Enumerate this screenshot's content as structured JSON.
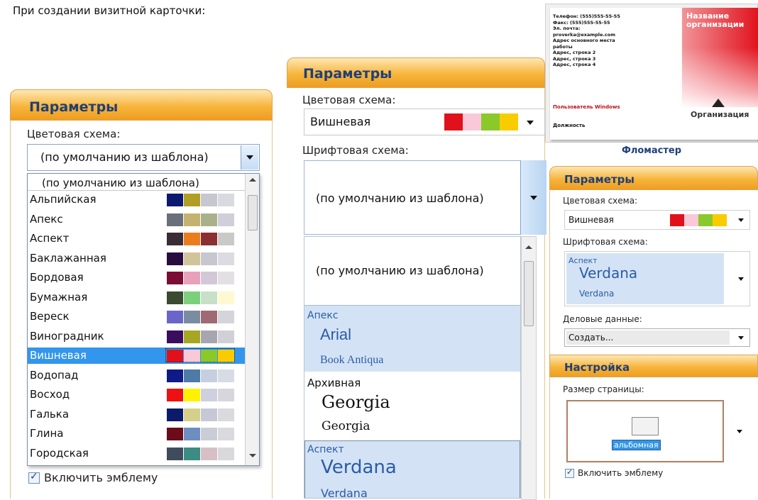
{
  "caption": "При создании визитной карточки:",
  "colors": {
    "accent": "#f7b53c",
    "header_text": "#1e3f7a",
    "selection": "#3296ec",
    "light_selection": "#d3e3f5"
  },
  "panel1": {
    "header": "Параметры",
    "color_scheme_label": "Цветовая схема:",
    "combo_value": "(по умолчанию из шаблона)",
    "list_first": "(по умолчанию из шаблона)",
    "items": [
      {
        "label": "Альпийская",
        "swatches": [
          "#0b1970",
          "#b09f22",
          "#c7c7d0",
          "#d9dae0"
        ]
      },
      {
        "label": "Апекс",
        "swatches": [
          "#69707a",
          "#c6b26f",
          "#a9b18a",
          "#d0ced9"
        ]
      },
      {
        "label": "Аспект",
        "swatches": [
          "#3a2c34",
          "#ea7c1e",
          "#8c2f32",
          "#cbc9c8"
        ]
      },
      {
        "label": "Баклажанная",
        "swatches": [
          "#2a0b3f",
          "#d2c49a",
          "#c7c7cf",
          "#dcdbe1"
        ]
      },
      {
        "label": "Бордовая",
        "swatches": [
          "#7b0c34",
          "#e8a1ba",
          "#d3c8d8",
          "#e3e0e4"
        ]
      },
      {
        "label": "Бумажная",
        "swatches": [
          "#3a4b2f",
          "#7cd07c",
          "#c7e0c7",
          "#fff8d0"
        ]
      },
      {
        "label": "Вереск",
        "swatches": [
          "#6a66c9",
          "#7a8ca0",
          "#a06a74",
          "#d4d4da"
        ]
      },
      {
        "label": "Виноградник",
        "swatches": [
          "#3a0d5e",
          "#a7a622",
          "#a7a6b0",
          "#d0d0d6"
        ]
      },
      {
        "label": "Вишневая",
        "swatches": [
          "#e0111b",
          "#f9c9d9",
          "#8ac92a",
          "#f9cc00"
        ],
        "selected": true
      },
      {
        "label": "Водопад",
        "swatches": [
          "#0e1a86",
          "#4d7ba6",
          "#c5cfe0",
          "#d6dbe4"
        ]
      },
      {
        "label": "Восход",
        "swatches": [
          "#ee1111",
          "#fff200",
          "#ced0e0",
          "#d6d6dc"
        ]
      },
      {
        "label": "Галька",
        "swatches": [
          "#0b1a6a",
          "#d4d08a",
          "#c6c8d6",
          "#d9d9de"
        ]
      },
      {
        "label": "Глина",
        "swatches": [
          "#6a0c1a",
          "#6d8ec0",
          "#cbcdd6",
          "#dadade"
        ]
      },
      {
        "label": "Городская",
        "swatches": [
          "#404b5e",
          "#3b8c82",
          "#d6c0c6",
          "#d9d9dc"
        ]
      }
    ],
    "checkbox_label": "Включить эмблему",
    "checkbox_checked": true
  },
  "panel2": {
    "header": "Параметры",
    "color_scheme_label": "Цветовая схема:",
    "color_scheme_value": "Вишневая",
    "color_swatches": [
      "#e0111b",
      "#f9c9d9",
      "#8ac92a",
      "#f9cc00"
    ],
    "font_scheme_label": "Шрифтовая схема:",
    "font_scheme_value": "(по умолчанию из шаблона)",
    "list_first": "(по умолчанию из шаблона)",
    "fonts": [
      {
        "name": "Апекс",
        "major": "Arial",
        "minor": "Book Antiqua"
      },
      {
        "name": "Архивная",
        "major": "Georgia",
        "minor": "Georgia"
      },
      {
        "name": "Аспект",
        "major": "Verdana",
        "minor": "Verdana"
      }
    ]
  },
  "panel3": {
    "card_lines": [
      "Телефон: (555)555-55-55",
      "Факс: (555)555-55-55",
      "Эл. почта:",
      "proverka@example.com",
      "Адрес основного места",
      "работы",
      "Адрес, строка 2",
      "Адрес, строка 3",
      "Адрес, строка 4"
    ],
    "card_user": "Пользователь Windows",
    "card_position": "Должность",
    "card_org_name": "Название организации",
    "card_org": "Организация",
    "template_name": "Фломастер",
    "header": "Параметры",
    "color_scheme_label": "Цветовая схема:",
    "color_scheme_value": "Вишневая",
    "color_swatches": [
      "#e0111b",
      "#f9c9d9",
      "#8ac92a",
      "#f9cc00"
    ],
    "font_scheme_label": "Шрифтовая схема:",
    "font_scheme_name": "Аспект",
    "font_major": "Verdana",
    "font_minor": "Verdana",
    "business_label": "Деловые данные:",
    "business_value": "Создать...",
    "settings_header": "Настройка",
    "page_size_label": "Размер страницы:",
    "page_size_value": "альбомная",
    "checkbox_label": "Включить эмблему",
    "checkbox_checked": true
  }
}
